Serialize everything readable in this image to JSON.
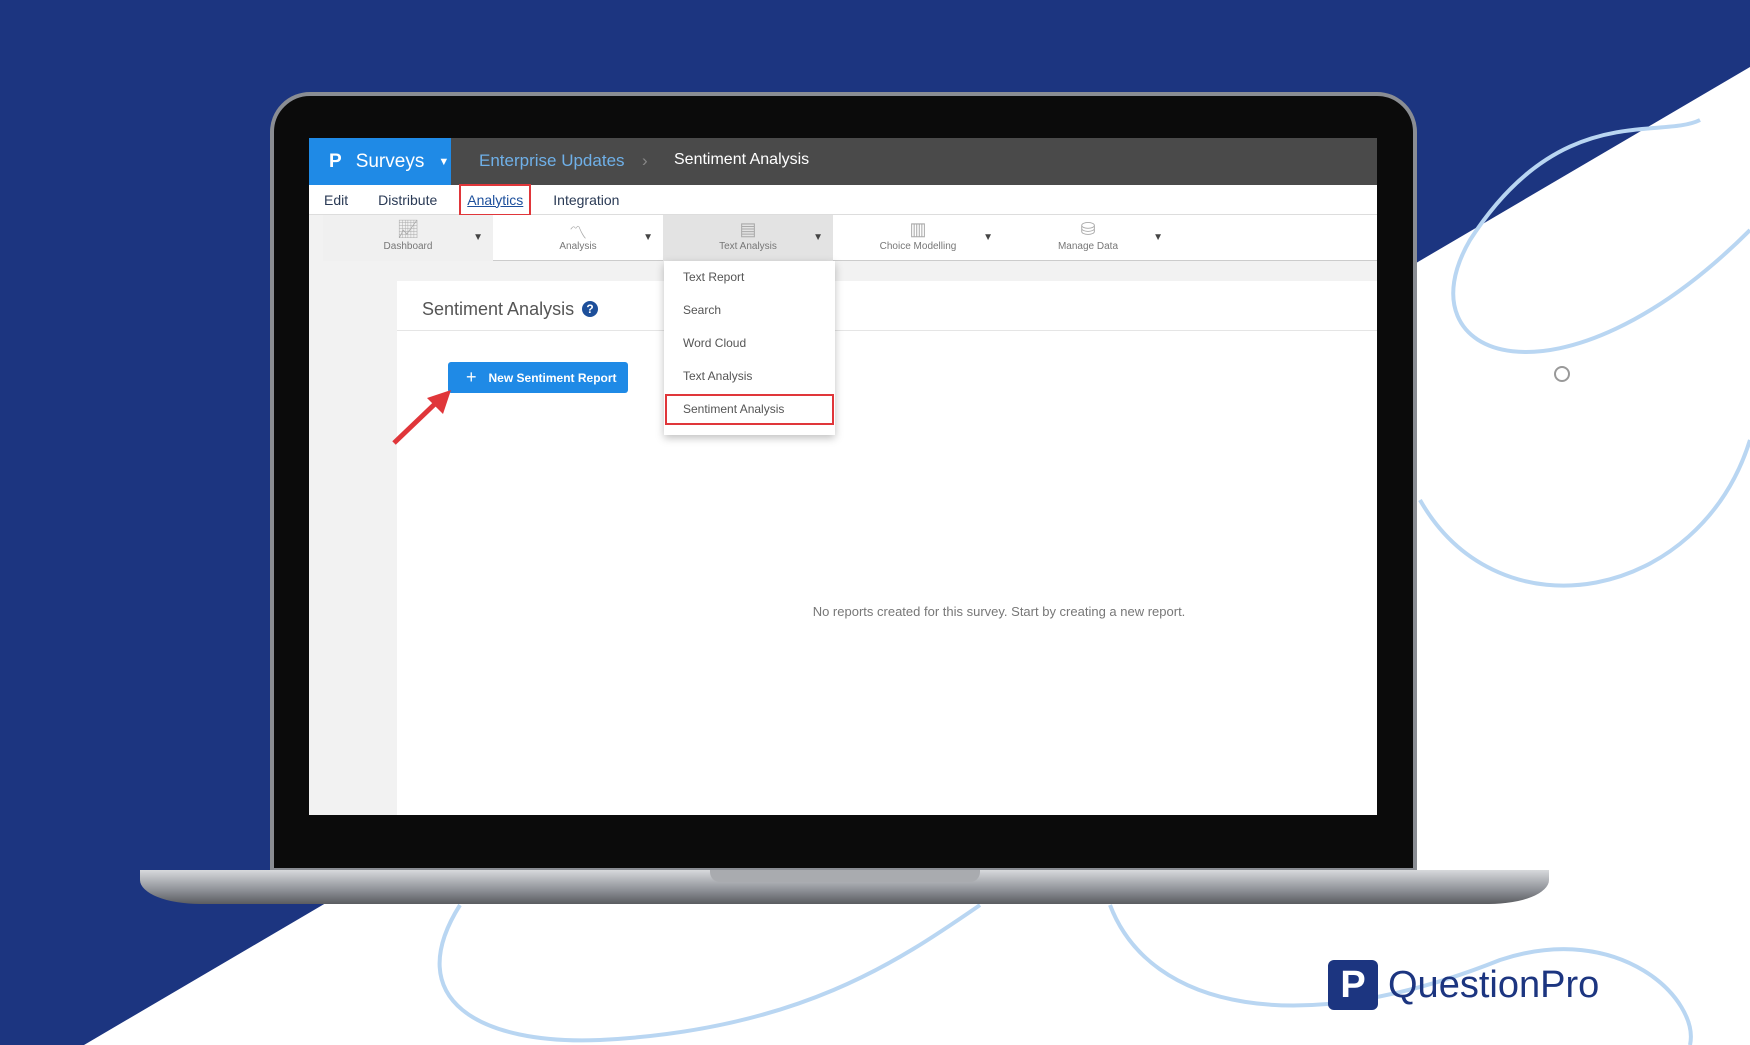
{
  "header": {
    "app": "Surveys",
    "breadcrumb_parent": "Enterprise Updates",
    "breadcrumb_sep": "›",
    "breadcrumb_current": "Sentiment Analysis"
  },
  "tabs": [
    "Edit",
    "Distribute",
    "Analytics",
    "Integration"
  ],
  "toolbar": [
    "Dashboard",
    "Analysis",
    "Text Analysis",
    "Choice Modelling",
    "Manage Data"
  ],
  "dropdown": [
    "Text Report",
    "Search",
    "Word Cloud",
    "Text Analysis",
    "Sentiment Analysis"
  ],
  "page": {
    "title": "Sentiment Analysis",
    "help": "?",
    "new_button": "New Sentiment Report",
    "empty_message": "No reports created for this survey. Start by creating a new report."
  },
  "brand": {
    "logo_text": "QuestionPro"
  },
  "colors": {
    "navy": "#1c3580",
    "accent": "#1f8ae6",
    "highlight": "#e0363a"
  }
}
